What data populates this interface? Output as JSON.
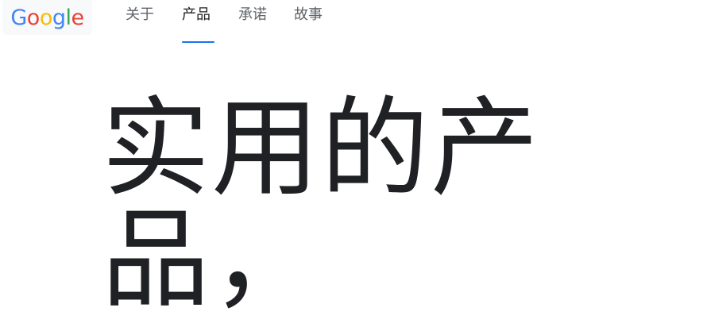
{
  "logo": {
    "letters": [
      {
        "char": "G",
        "color": "#4285F4"
      },
      {
        "char": "o",
        "color": "#EA4335"
      },
      {
        "char": "o",
        "color": "#FBBC05"
      },
      {
        "char": "g",
        "color": "#4285F4"
      },
      {
        "char": "l",
        "color": "#34A853"
      },
      {
        "char": "e",
        "color": "#EA4335"
      }
    ]
  },
  "nav": {
    "items": [
      {
        "label": "关于",
        "active": false
      },
      {
        "label": "产品",
        "active": true
      },
      {
        "label": "承诺",
        "active": false
      },
      {
        "label": "故事",
        "active": false
      }
    ],
    "accent_color": "#1a73e8"
  },
  "hero": {
    "title": "实用的产品，"
  }
}
